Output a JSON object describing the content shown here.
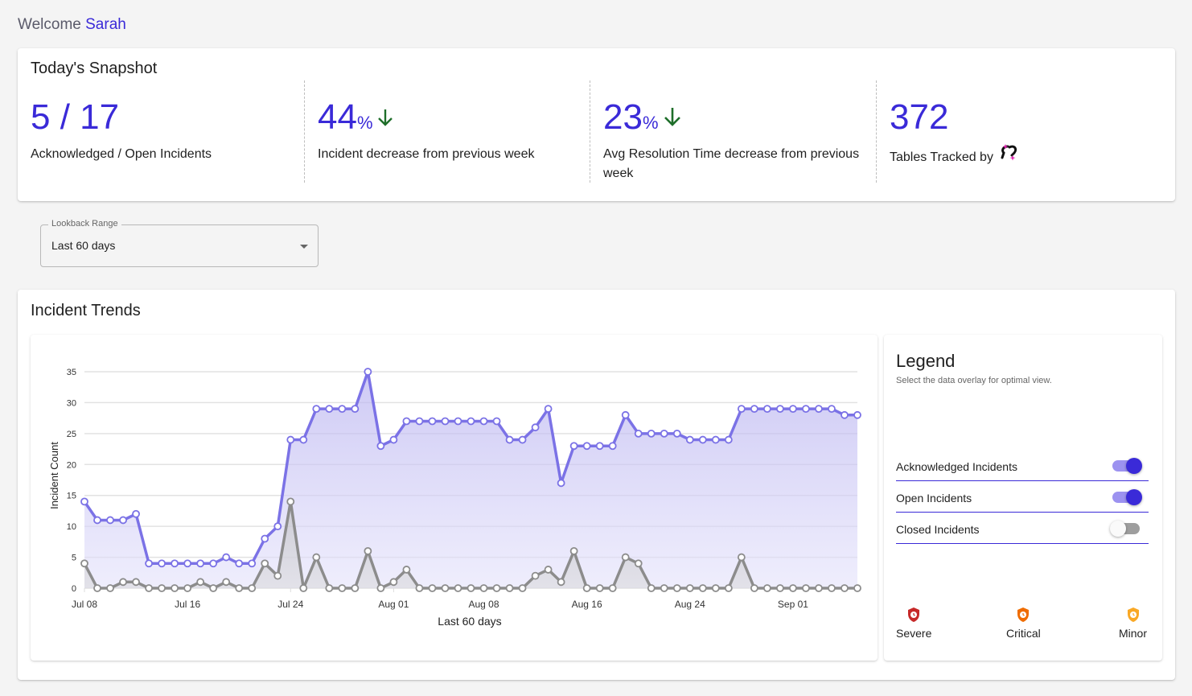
{
  "welcome": {
    "prefix": "Welcome",
    "name": "Sarah"
  },
  "snapshot": {
    "title": "Today's Snapshot",
    "stats": [
      {
        "value": "5 / 17",
        "suffix": "",
        "trend": "",
        "label": "Acknowledged / Open Incidents"
      },
      {
        "value": "44",
        "suffix": "%",
        "trend": "down",
        "label": "Incident decrease from previous week"
      },
      {
        "value": "23",
        "suffix": "%",
        "trend": "down",
        "label": "Avg Resolution Time decrease from previous week"
      },
      {
        "value": "372",
        "suffix": "",
        "trend": "",
        "label": "Tables Tracked by",
        "logo": "brand-logo-icon"
      }
    ]
  },
  "lookback": {
    "label": "Lookback Range",
    "value": "Last 60 days",
    "icon": "caret-down-icon"
  },
  "trends": {
    "title": "Incident Trends",
    "legend": {
      "title": "Legend",
      "subtitle": "Select the data overlay for optimal view.",
      "toggles": [
        {
          "label": "Acknowledged Incidents",
          "on": true
        },
        {
          "label": "Open Incidents",
          "on": true
        },
        {
          "label": "Closed Incidents",
          "on": false
        }
      ],
      "severities": [
        {
          "label": "Severe",
          "icon": "shield-clock-icon",
          "color": "#c62828"
        },
        {
          "label": "Critical",
          "icon": "shield-clock-icon",
          "color": "#ef6c00"
        },
        {
          "label": "Minor",
          "icon": "shield-clock-icon",
          "color": "#f9a825"
        }
      ]
    }
  },
  "colors": {
    "accent": "#3a2ad8",
    "acknowledged_line": "#7b72e6",
    "open_line": "#8c8c8c",
    "trend_down": "#1e6e2a"
  },
  "chart_data": {
    "type": "area",
    "title": "",
    "xlabel": "Last 60 days",
    "ylabel": "Incident Count",
    "ylim": [
      0,
      35
    ],
    "yticks": [
      0,
      5,
      10,
      15,
      20,
      25,
      30,
      35
    ],
    "grid": true,
    "xticks": [
      {
        "index": 0,
        "label": "Jul 08"
      },
      {
        "index": 8,
        "label": "Jul 16"
      },
      {
        "index": 16,
        "label": "Jul 24"
      },
      {
        "index": 24,
        "label": "Aug 01"
      },
      {
        "index": 31,
        "label": "Aug 08"
      },
      {
        "index": 39,
        "label": "Aug 16"
      },
      {
        "index": 47,
        "label": "Aug 24"
      },
      {
        "index": 55,
        "label": "Sep 01"
      }
    ],
    "series": [
      {
        "name": "Acknowledged Incidents",
        "color": "#7b72e6",
        "values": [
          14,
          11,
          11,
          11,
          12,
          4,
          4,
          4,
          4,
          4,
          4,
          5,
          4,
          4,
          8,
          10,
          24,
          24,
          29,
          29,
          29,
          29,
          35,
          23,
          24,
          27,
          27,
          27,
          27,
          27,
          27,
          27,
          27,
          24,
          24,
          26,
          29,
          17,
          23,
          23,
          23,
          23,
          28,
          25,
          25,
          25,
          25,
          24,
          24,
          24,
          24,
          29,
          29,
          29,
          29,
          29,
          29,
          29,
          29,
          28,
          28
        ]
      },
      {
        "name": "Open Incidents",
        "color": "#8c8c8c",
        "values": [
          4,
          0,
          0,
          1,
          1,
          0,
          0,
          0,
          0,
          1,
          0,
          1,
          0,
          0,
          4,
          2,
          14,
          0,
          5,
          0,
          0,
          0,
          6,
          0,
          1,
          3,
          0,
          0,
          0,
          0,
          0,
          0,
          0,
          0,
          0,
          2,
          3,
          1,
          6,
          0,
          0,
          0,
          5,
          4,
          0,
          0,
          0,
          0,
          0,
          0,
          0,
          5,
          0,
          0,
          0,
          0,
          0,
          0,
          0,
          0,
          0
        ]
      }
    ]
  }
}
